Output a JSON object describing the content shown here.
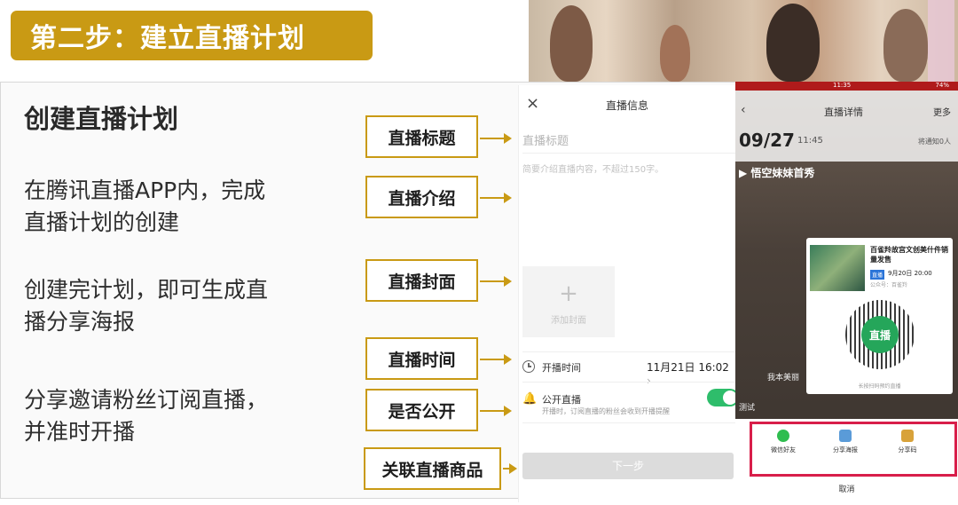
{
  "banner": {
    "step_title": "第二步：建立直播计划"
  },
  "main": {
    "title": "创建直播计划",
    "para1": "在腾讯直播APP内，完成\n直播计划的创建",
    "para2": "创建完计划，即可生成直\n播分享海报",
    "para3": "分享邀请粉丝订阅直播，\n并准时开播"
  },
  "callouts": [
    "直播标题",
    "直播介绍",
    "直播封面",
    "直播时间",
    "是否公开",
    "关联直播商品"
  ],
  "form": {
    "close_icon": "×",
    "header": "直播信息",
    "title_placeholder": "直播标题",
    "intro_placeholder": "简要介绍直播内容，不超过150字。",
    "cover_plus": "+",
    "cover_label": "添加封面",
    "time_label": "开播时间",
    "time_value": "11月21日 16:02",
    "time_chevron": "›",
    "public_label": "公开直播",
    "public_sub": "开播时，订阅直播的粉丝会收到开播提醒",
    "public_enabled": true,
    "next_button": "下一步"
  },
  "detail": {
    "status_time": "11:35",
    "status_battery": "74%",
    "back_icon": "‹",
    "header": "直播详情",
    "more": "更多",
    "date": "09/27",
    "hour": "11:45",
    "notified": "将通知0人",
    "show_title": "悟空妹妹首秀",
    "poster_title": "百雀羚故宫文创美什件销量发售",
    "poster_badge": "直播",
    "poster_time": "9月20日 20:00",
    "poster_pub": "公众号：百雀羚",
    "qr_label": "直播",
    "poster_hint": "长按扫码预约直播",
    "streamer": "我本美丽",
    "test": "测试",
    "share": [
      "微信好友",
      "分享海报",
      "分享码"
    ],
    "cancel": "取消"
  },
  "colors": {
    "accent_gold": "#c99a14",
    "toggle_green": "#2ebd6b",
    "share_frame": "#d81e4a"
  }
}
